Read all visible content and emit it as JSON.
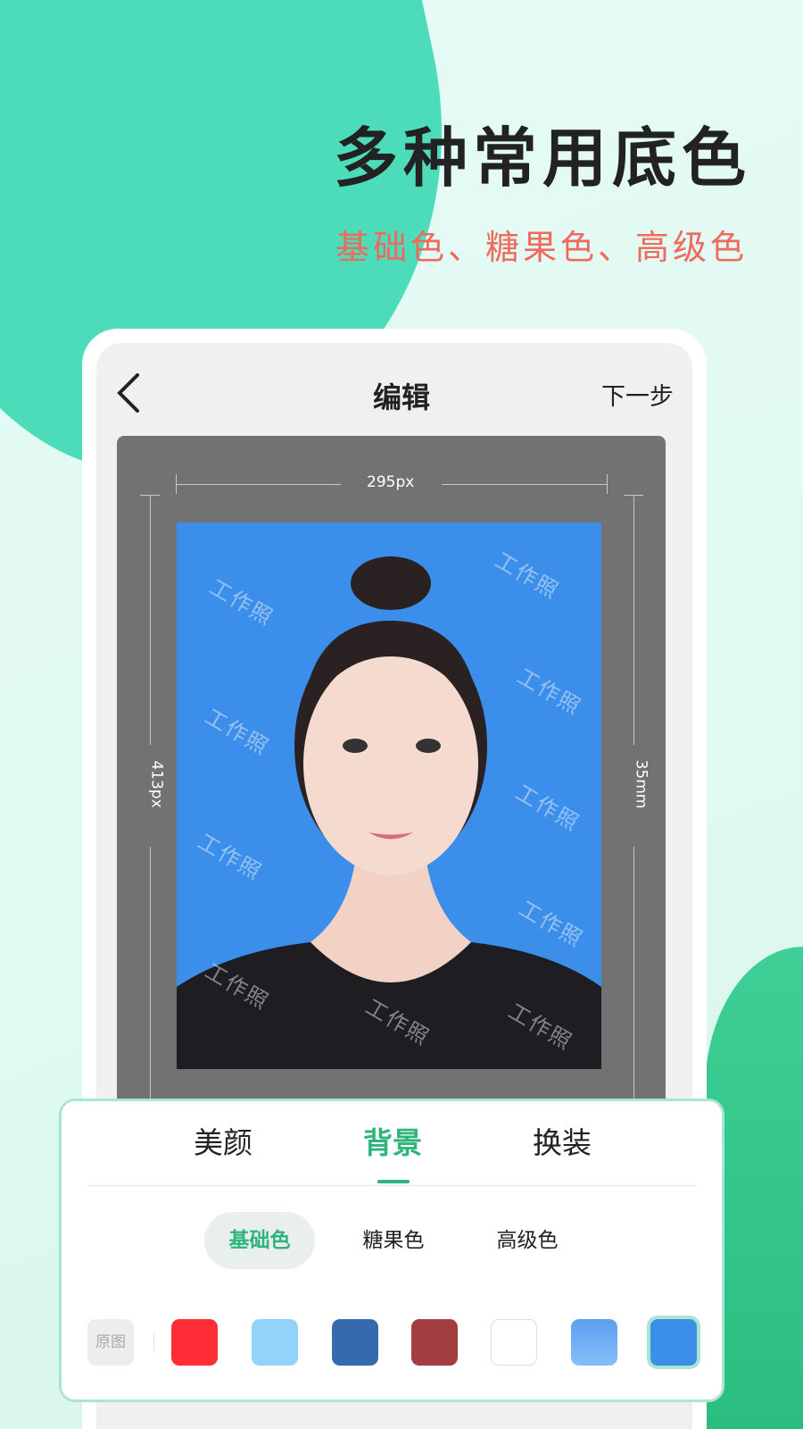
{
  "promo": {
    "headline": "多种常用底色",
    "subheadline": "基础色、糖果色、高级色"
  },
  "header": {
    "back_icon": "chevron-left-icon",
    "title": "编辑",
    "next": "下一步"
  },
  "photo": {
    "width_label": "295px",
    "height_label": "413px",
    "size_label": "35mm",
    "watermark": "工作照",
    "background_color": "#3b8eea"
  },
  "tabs": [
    {
      "label": "美颜"
    },
    {
      "label": "背景",
      "active": true
    },
    {
      "label": "换装"
    }
  ],
  "categories": [
    {
      "label": "基础色",
      "active": true
    },
    {
      "label": "糖果色"
    },
    {
      "label": "高级色"
    }
  ],
  "swatches": {
    "original_label": "原图",
    "colors": [
      "#ff2d35",
      "#93d3fb",
      "#356bae",
      "#a33d3f",
      "#ffffff",
      "#6aaaf5",
      "#3b8eea"
    ],
    "selected": "#3b8eea"
  },
  "accent": "#2fb47d"
}
